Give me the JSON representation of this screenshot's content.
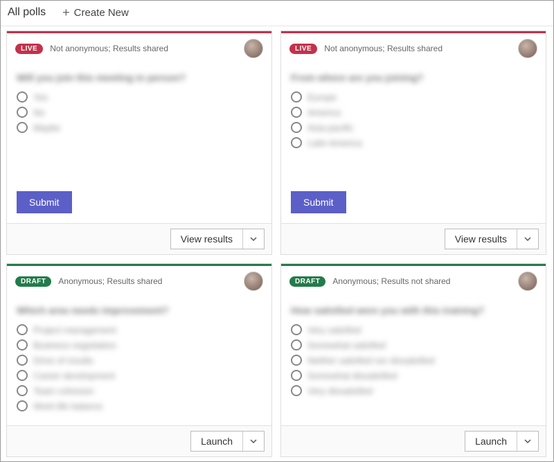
{
  "header": {
    "title": "All polls",
    "create_label": "Create New"
  },
  "labels": {
    "submit": "Submit",
    "view_results": "View results",
    "launch": "Launch"
  },
  "badges": {
    "live": "LIVE",
    "draft": "DRAFT"
  },
  "polls": [
    {
      "status": "live",
      "meta": "Not anonymous; Results shared",
      "question": "Will you join this meeting in person?",
      "options": [
        "Yes",
        "No",
        "Maybe"
      ],
      "action": "view_results",
      "show_submit": true
    },
    {
      "status": "live",
      "meta": "Not anonymous; Results shared",
      "question": "From where are you joining?",
      "options": [
        "Europe",
        "America",
        "Asia-pacific",
        "Latin America"
      ],
      "action": "view_results",
      "show_submit": true
    },
    {
      "status": "draft",
      "meta": "Anonymous; Results shared",
      "question": "Which area needs improvement?",
      "options": [
        "Project management",
        "Business negotiation",
        "Drive of results",
        "Career development",
        "Team cohesion",
        "Work-life balance"
      ],
      "action": "launch",
      "show_submit": false
    },
    {
      "status": "draft",
      "meta": "Anonymous; Results not shared",
      "question": "How satisfied were you with this training?",
      "options": [
        "Very satisfied",
        "Somewhat satisfied",
        "Neither satisfied nor dissatisfied",
        "Somewhat dissatisfied",
        "Very dissatisfied"
      ],
      "action": "launch",
      "show_submit": false
    }
  ]
}
